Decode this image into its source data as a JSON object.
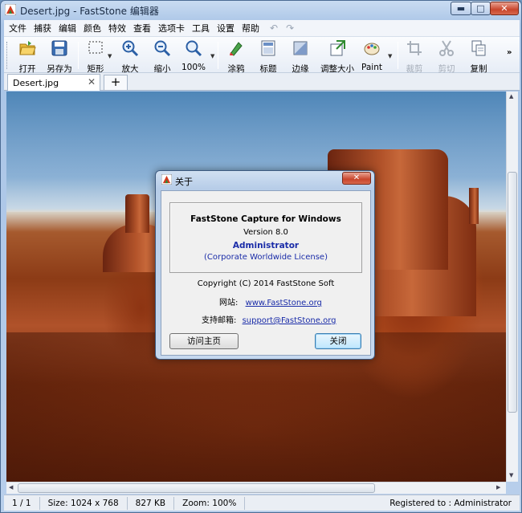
{
  "window": {
    "title": "Desert.jpg - FastStone 编辑器"
  },
  "menu": [
    "文件",
    "捕获",
    "编辑",
    "颜色",
    "特效",
    "查看",
    "选项卡",
    "工具",
    "设置",
    "帮助"
  ],
  "toolbar": {
    "open": "打开",
    "save_as": "另存为",
    "rect": "矩形",
    "zoom_in": "放大",
    "zoom_out": "缩小",
    "zoom_100": "100%",
    "draw": "涂鸦",
    "caption": "标题",
    "edge": "边缘",
    "resize": "调整大小",
    "paint": "Paint",
    "crop": "裁剪",
    "cut": "剪切",
    "copy": "复制"
  },
  "tabs": {
    "active": "Desert.jpg"
  },
  "status": {
    "page": "1 / 1",
    "size": "Size: 1024 x 768",
    "file_size": "827 KB",
    "zoom": "Zoom: 100%",
    "registered": "Registered to : Administrator"
  },
  "dialog": {
    "title": "关于",
    "product": "FastStone Capture for Windows",
    "version": "Version 8.0",
    "user": "Administrator",
    "license": "(Corporate Worldwide License)",
    "copyright": "Copyright (C) 2014 FastStone Soft",
    "website_label": "网站:",
    "website": "www.FastStone.org",
    "email_label": "支持邮箱:",
    "email": "support@FastStone.org",
    "home_button": "访问主页",
    "close_button": "关闭"
  },
  "colors": {
    "accent": "#1a2ca8",
    "close_red": "#c9452c"
  }
}
